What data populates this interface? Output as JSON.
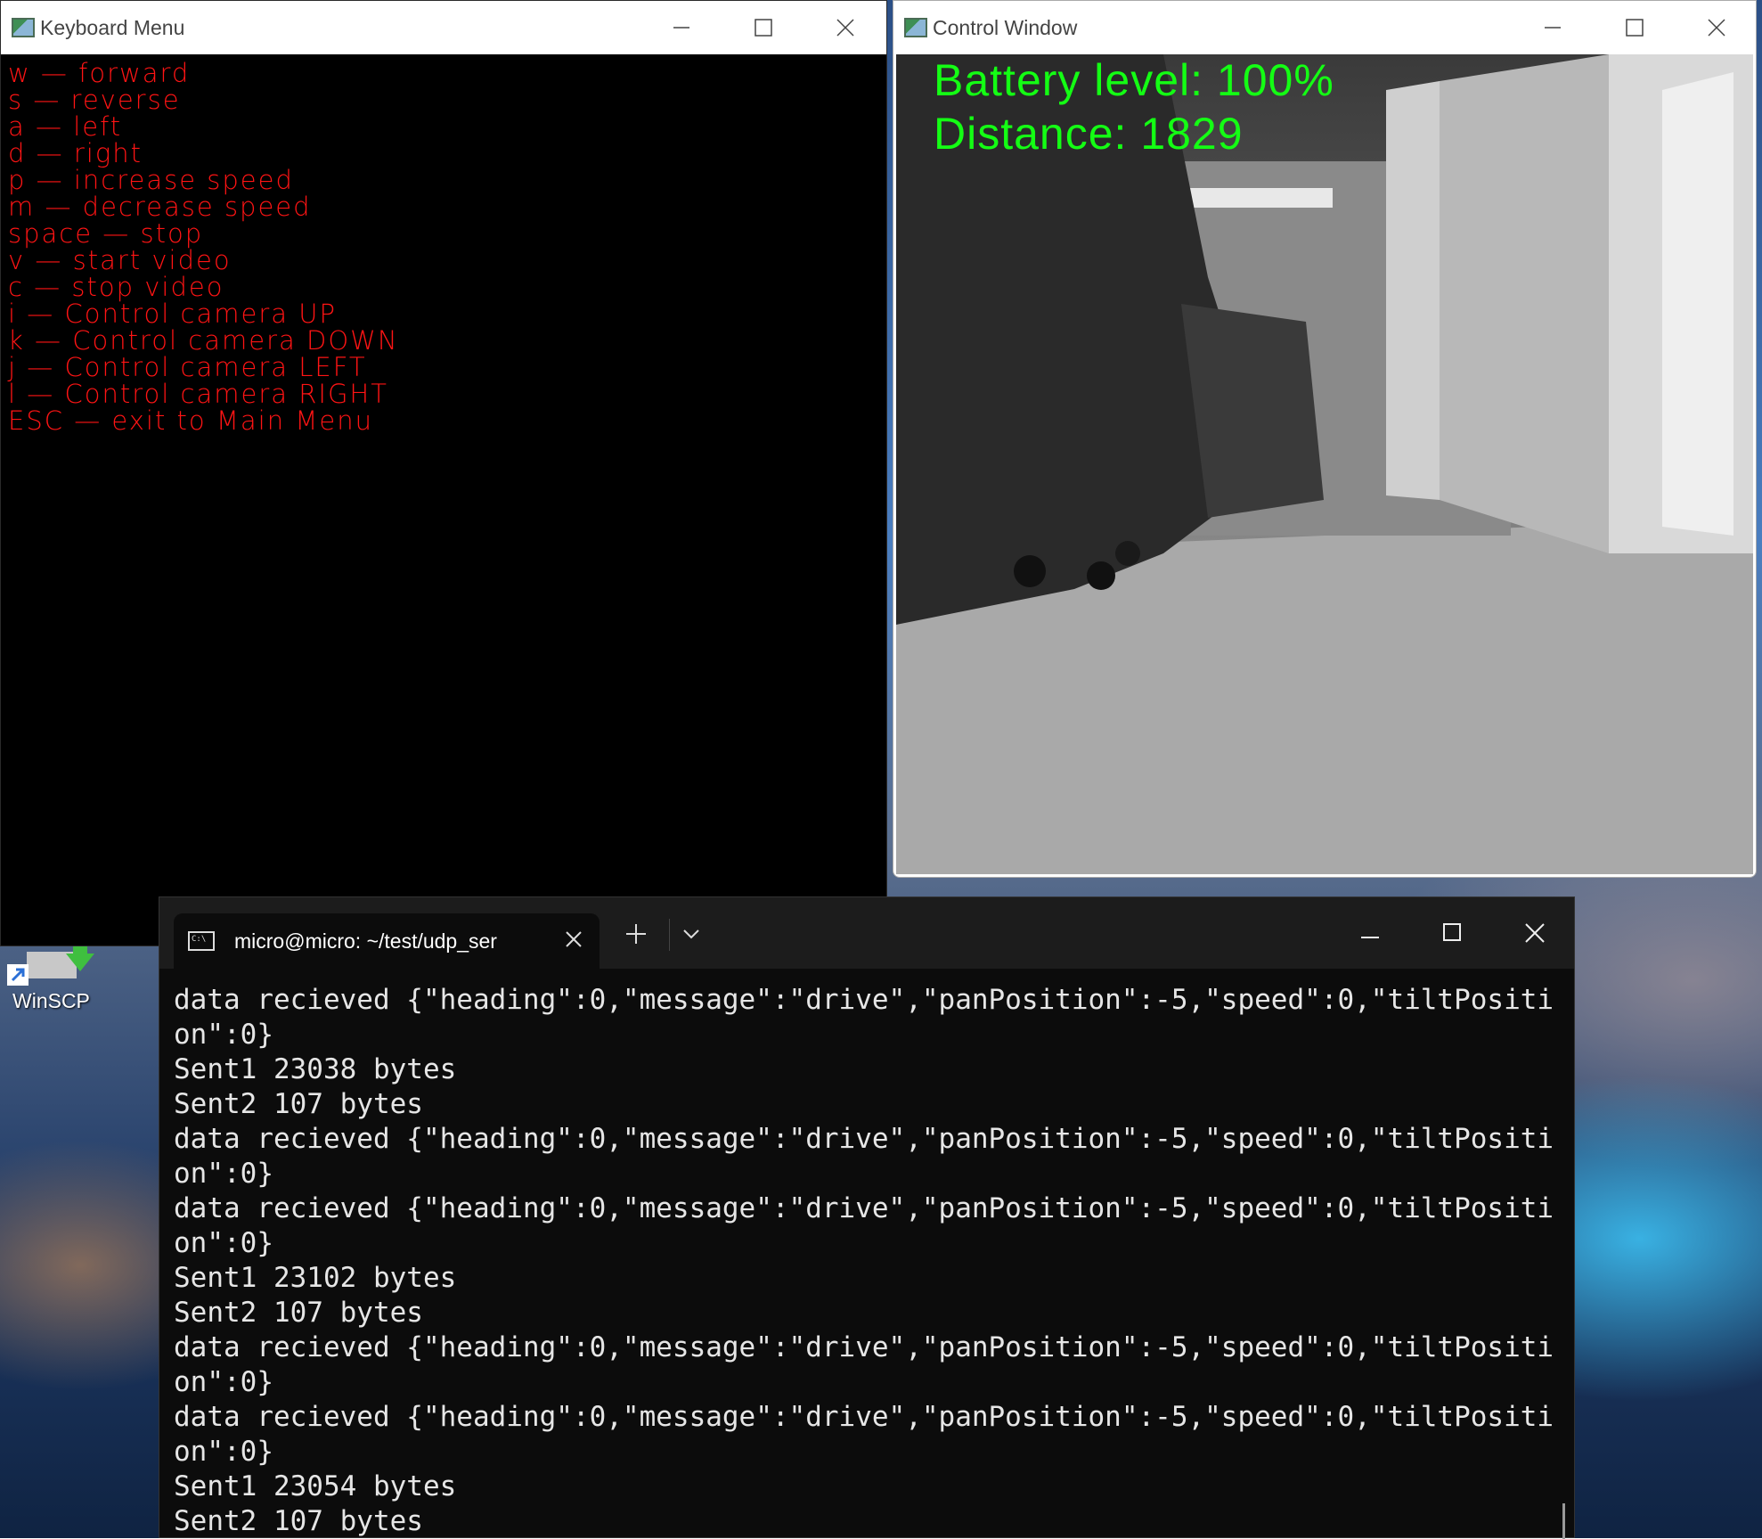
{
  "keyboard_menu": {
    "title": "Keyboard Menu",
    "items": [
      "w — forward",
      "s — reverse",
      "a — left",
      "d — right",
      "p — increase speed",
      "m — decrease speed",
      "space — stop",
      "v — start video",
      "c — stop video",
      "i — Control camera UP",
      "k — Control camera DOWN",
      "j — Control camera LEFT",
      "l — Control camera RIGHT",
      "ESC — exit to Main Menu"
    ]
  },
  "control_window": {
    "title": "Control Window",
    "battery_text": "Battery level: 100%",
    "distance_text": "Distance: 1829"
  },
  "terminal": {
    "tab_title": "micro@micro: ~/test/udp_ser",
    "lines": [
      "data recieved {\"heading\":0,\"message\":\"drive\",\"panPosition\":-5,\"speed\":0,\"tiltPosition\":0}",
      "Sent1 23038 bytes",
      "Sent2 107 bytes",
      "data recieved {\"heading\":0,\"message\":\"drive\",\"panPosition\":-5,\"speed\":0,\"tiltPosition\":0}",
      "data recieved {\"heading\":0,\"message\":\"drive\",\"panPosition\":-5,\"speed\":0,\"tiltPosition\":0}",
      "Sent1 23102 bytes",
      "Sent2 107 bytes",
      "data recieved {\"heading\":0,\"message\":\"drive\",\"panPosition\":-5,\"speed\":0,\"tiltPosition\":0}",
      "data recieved {\"heading\":0,\"message\":\"drive\",\"panPosition\":-5,\"speed\":0,\"tiltPosition\":0}",
      "Sent1 23054 bytes",
      "Sent2 107 bytes"
    ]
  },
  "desktop": {
    "icon_label": "WinSCP"
  },
  "colors": {
    "menu_text": "#ff1414",
    "overlay_text": "#14ff14",
    "terminal_bg": "#0c0c0c"
  }
}
